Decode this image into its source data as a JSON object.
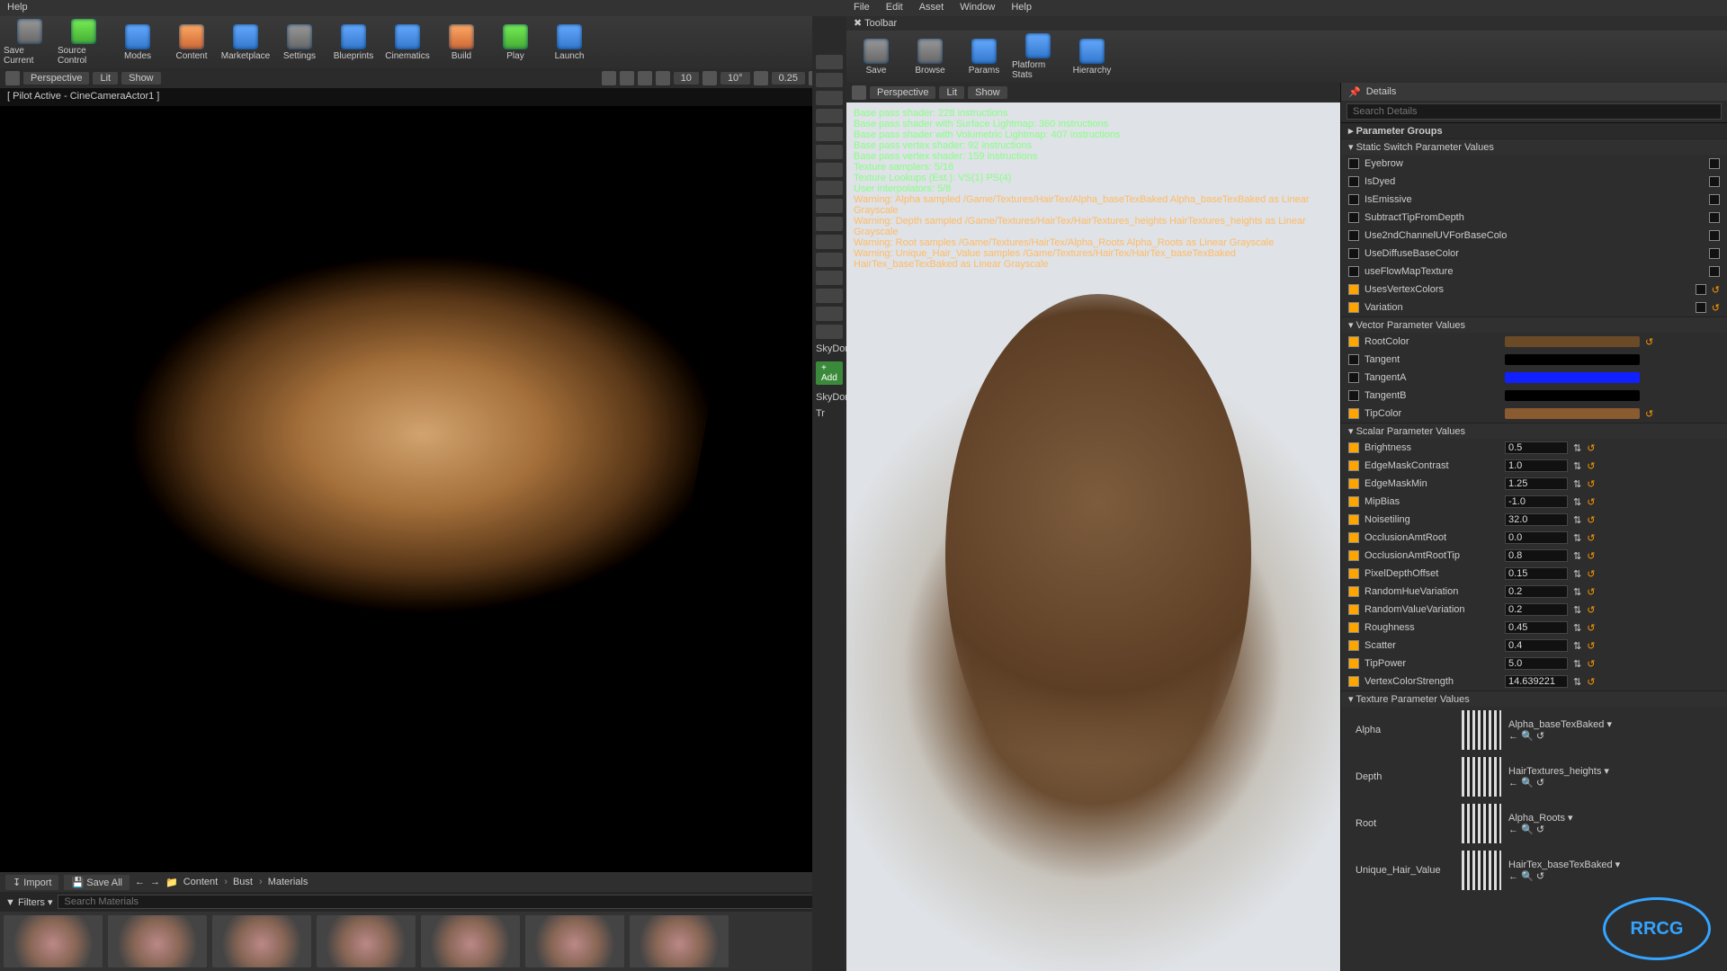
{
  "left": {
    "menus": [
      "Help"
    ],
    "toolbar": [
      {
        "label": "Save Current",
        "cls": "grey"
      },
      {
        "label": "Source Control",
        "cls": "green"
      },
      {
        "label": "Modes",
        "cls": ""
      },
      {
        "label": "Content",
        "cls": "orange"
      },
      {
        "label": "Marketplace",
        "cls": ""
      },
      {
        "label": "Settings",
        "cls": "grey"
      },
      {
        "label": "Blueprints",
        "cls": ""
      },
      {
        "label": "Cinematics",
        "cls": ""
      },
      {
        "label": "Build",
        "cls": "orange"
      },
      {
        "label": "Play",
        "cls": "green"
      },
      {
        "label": "Launch",
        "cls": ""
      }
    ],
    "vp_perspective": "Perspective",
    "vp_lit": "Lit",
    "vp_show": "Show",
    "vp_speed": "10",
    "vp_grid": "10°",
    "vp_scale": "0.25",
    "pilot": "[ Pilot Active - CineCameraActor1 ]",
    "cb_import": "Import",
    "cb_saveall": "Save All",
    "cb_path": [
      "Content",
      "Bust",
      "Materials"
    ],
    "cb_filters": "Filters",
    "cb_search_ph": "Search Materials",
    "outliner_add": "+ Add",
    "outliner_items": [
      "SkyDome",
      "SkyDome",
      "Tr"
    ]
  },
  "right": {
    "menus": [
      "File",
      "Edit",
      "Asset",
      "Window",
      "Help"
    ],
    "toolbar_tab": "Toolbar",
    "toolbar": [
      {
        "label": "Save",
        "cls": "grey"
      },
      {
        "label": "Browse",
        "cls": "grey"
      },
      {
        "label": "Params",
        "cls": ""
      },
      {
        "label": "Platform Stats",
        "cls": ""
      },
      {
        "label": "Hierarchy",
        "cls": ""
      }
    ],
    "pv_perspective": "Perspective",
    "pv_lit": "Lit",
    "pv_show": "Show",
    "diag": {
      "greens": [
        "Base pass shader: 228 instructions",
        "Base pass shader with Surface Lightmap: 360 instructions",
        "Base pass shader with Volumetric Lightmap: 407 instructions",
        "Base pass vertex shader: 92 instructions",
        "Base pass vertex shader: 159 instructions",
        "Texture samplers: 5/16",
        "Texture Lookups (Est.): VS(1) PS(4)",
        "User interpolators: 5/8"
      ],
      "warns": [
        "Warning: Alpha sampled /Game/Textures/HairTex/Alpha_baseTexBaked Alpha_baseTexBaked as Linear Grayscale",
        "Warning: Depth sampled /Game/Textures/HairTex/HairTextures_heights HairTextures_heights as Linear Grayscale",
        "Warning: Root samples /Game/Textures/HairTex/Alpha_Roots Alpha_Roots as Linear Grayscale",
        "Warning: Unique_Hair_Value samples /Game/Textures/HairTex/HairTex_baseTexBaked HairTex_baseTexBaked as Linear Grayscale"
      ]
    },
    "panel": "Details",
    "search_ph": "Search Details",
    "grp_root": "Parameter Groups",
    "grp_static": "Static Switch Parameter Values",
    "static": [
      {
        "on": false,
        "name": "Eyebrow"
      },
      {
        "on": false,
        "name": "IsDyed"
      },
      {
        "on": false,
        "name": "IsEmissive"
      },
      {
        "on": false,
        "name": "SubtractTipFromDepth"
      },
      {
        "on": false,
        "name": "Use2ndChannelUVForBaseColo"
      },
      {
        "on": false,
        "name": "UseDiffuseBaseColor"
      },
      {
        "on": false,
        "name": "useFlowMapTexture"
      },
      {
        "on": true,
        "name": "UsesVertexColors"
      },
      {
        "on": true,
        "name": "Variation"
      }
    ],
    "grp_vector": "Vector Parameter Values",
    "vectors": [
      {
        "on": true,
        "name": "RootColor",
        "color": "#6b4a28"
      },
      {
        "on": false,
        "name": "Tangent",
        "color": "#000000"
      },
      {
        "on": false,
        "name": "TangentA",
        "color": "#1020ff"
      },
      {
        "on": false,
        "name": "TangentB",
        "color": "#000000"
      },
      {
        "on": true,
        "name": "TipColor",
        "color": "#8a5a30"
      }
    ],
    "grp_scalar": "Scalar Parameter Values",
    "scalars": [
      {
        "on": true,
        "name": "Brightness",
        "val": "0.5"
      },
      {
        "on": true,
        "name": "EdgeMaskContrast",
        "val": "1.0"
      },
      {
        "on": true,
        "name": "EdgeMaskMin",
        "val": "1.25"
      },
      {
        "on": true,
        "name": "MipBias",
        "val": "-1.0"
      },
      {
        "on": true,
        "name": "Noisetiling",
        "val": "32.0"
      },
      {
        "on": true,
        "name": "OcclusionAmtRoot",
        "val": "0.0"
      },
      {
        "on": true,
        "name": "OcclusionAmtRootTip",
        "val": "0.8"
      },
      {
        "on": true,
        "name": "PixelDepthOffset",
        "val": "0.15"
      },
      {
        "on": true,
        "name": "RandomHueVariation",
        "val": "0.2"
      },
      {
        "on": true,
        "name": "RandomValueVariation",
        "val": "0.2"
      },
      {
        "on": true,
        "name": "Roughness",
        "val": "0.45"
      },
      {
        "on": true,
        "name": "Scatter",
        "val": "0.4"
      },
      {
        "on": true,
        "name": "TipPower",
        "val": "5.0"
      },
      {
        "on": true,
        "name": "VertexColorStrength",
        "val": "14.639221"
      }
    ],
    "grp_tex": "Texture Parameter Values",
    "textures": [
      {
        "on": true,
        "name": "Alpha",
        "tex": "Alpha_baseTexBaked"
      },
      {
        "on": true,
        "name": "Depth",
        "tex": "HairTextures_heights"
      },
      {
        "on": true,
        "name": "Root",
        "tex": "Alpha_Roots"
      },
      {
        "on": true,
        "name": "Unique_Hair_Value",
        "tex": "HairTex_baseTexBaked"
      }
    ]
  },
  "watermark": "RRCG"
}
